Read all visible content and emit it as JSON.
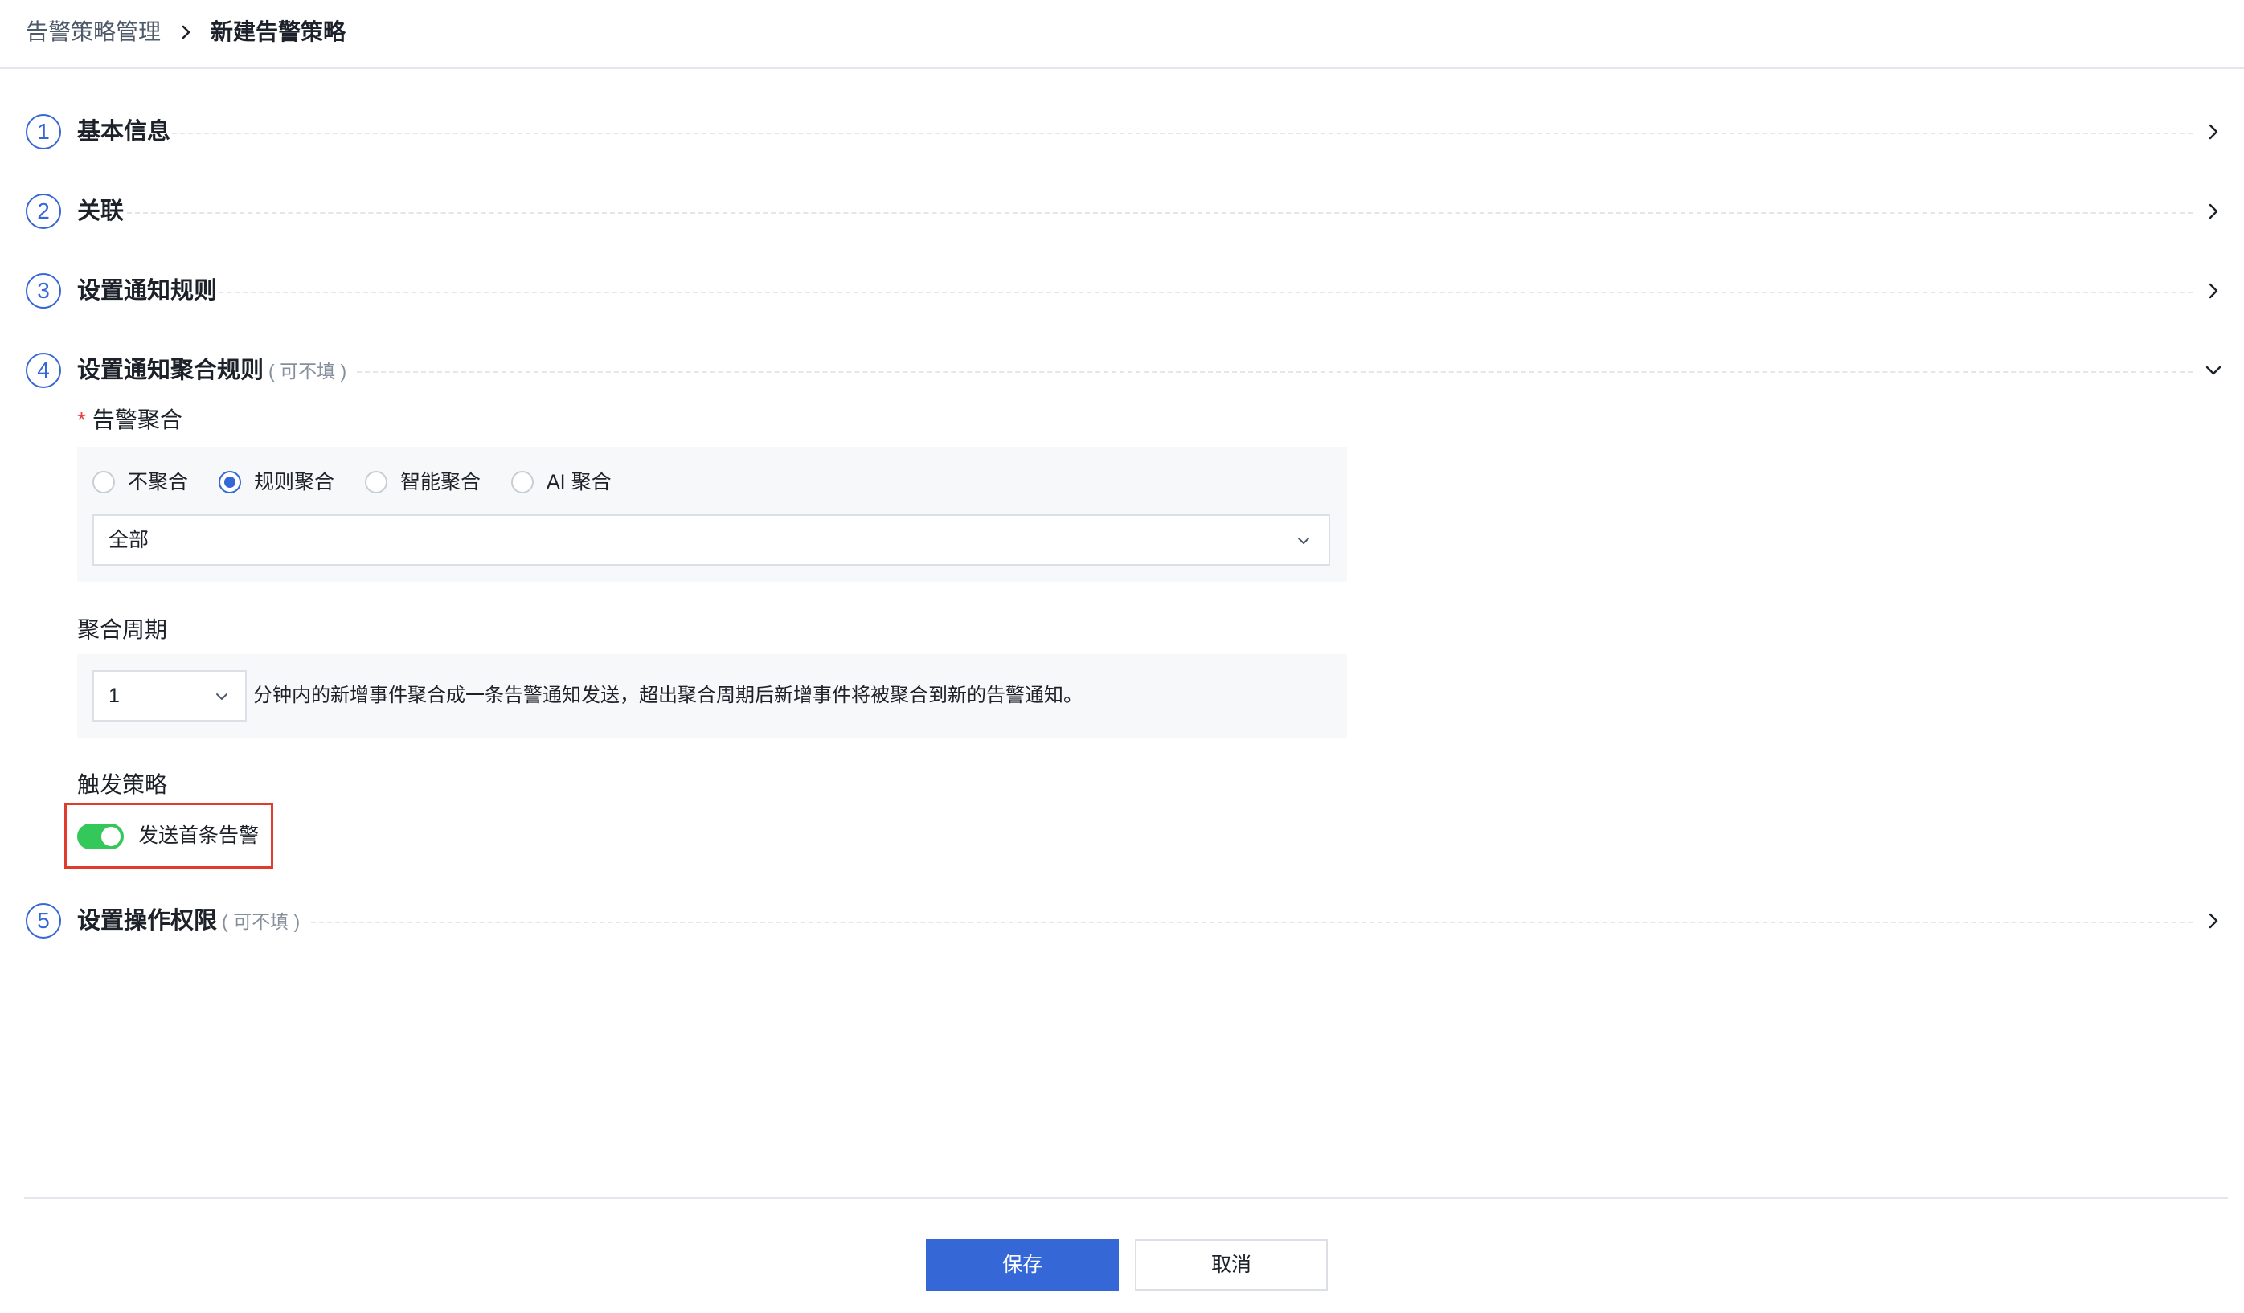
{
  "breadcrumb": {
    "parent": "告警策略管理",
    "current": "新建告警策略"
  },
  "steps": [
    {
      "num": "1",
      "title": "基本信息",
      "optional": "",
      "state": "collapsed"
    },
    {
      "num": "2",
      "title": "关联",
      "optional": "",
      "state": "collapsed"
    },
    {
      "num": "3",
      "title": "设置通知规则",
      "optional": "",
      "state": "collapsed"
    },
    {
      "num": "4",
      "title": "设置通知聚合规则",
      "optional": "( 可不填 )",
      "state": "expanded"
    },
    {
      "num": "5",
      "title": "设置操作权限",
      "optional": "( 可不填 )",
      "state": "collapsed"
    }
  ],
  "aggregation": {
    "label": "告警聚合",
    "required_mark": "*",
    "options": [
      {
        "label": "不聚合",
        "selected": false
      },
      {
        "label": "规则聚合",
        "selected": true
      },
      {
        "label": "智能聚合",
        "selected": false
      },
      {
        "label": "AI 聚合",
        "selected": false
      }
    ],
    "scope_select": "全部"
  },
  "period": {
    "label": "聚合周期",
    "value": "1",
    "description": "分钟内的新增事件聚合成一条告警通知发送，超出聚合周期后新增事件将被聚合到新的告警通知。"
  },
  "trigger": {
    "label": "触发策略",
    "toggle_label": "发送首条告警",
    "toggle_on": true
  },
  "footer": {
    "save": "保存",
    "cancel": "取消"
  },
  "colors": {
    "accent": "#3667d6",
    "toggle_on": "#34c759",
    "highlight_border": "#e03c2d",
    "required": "#e8423b"
  }
}
